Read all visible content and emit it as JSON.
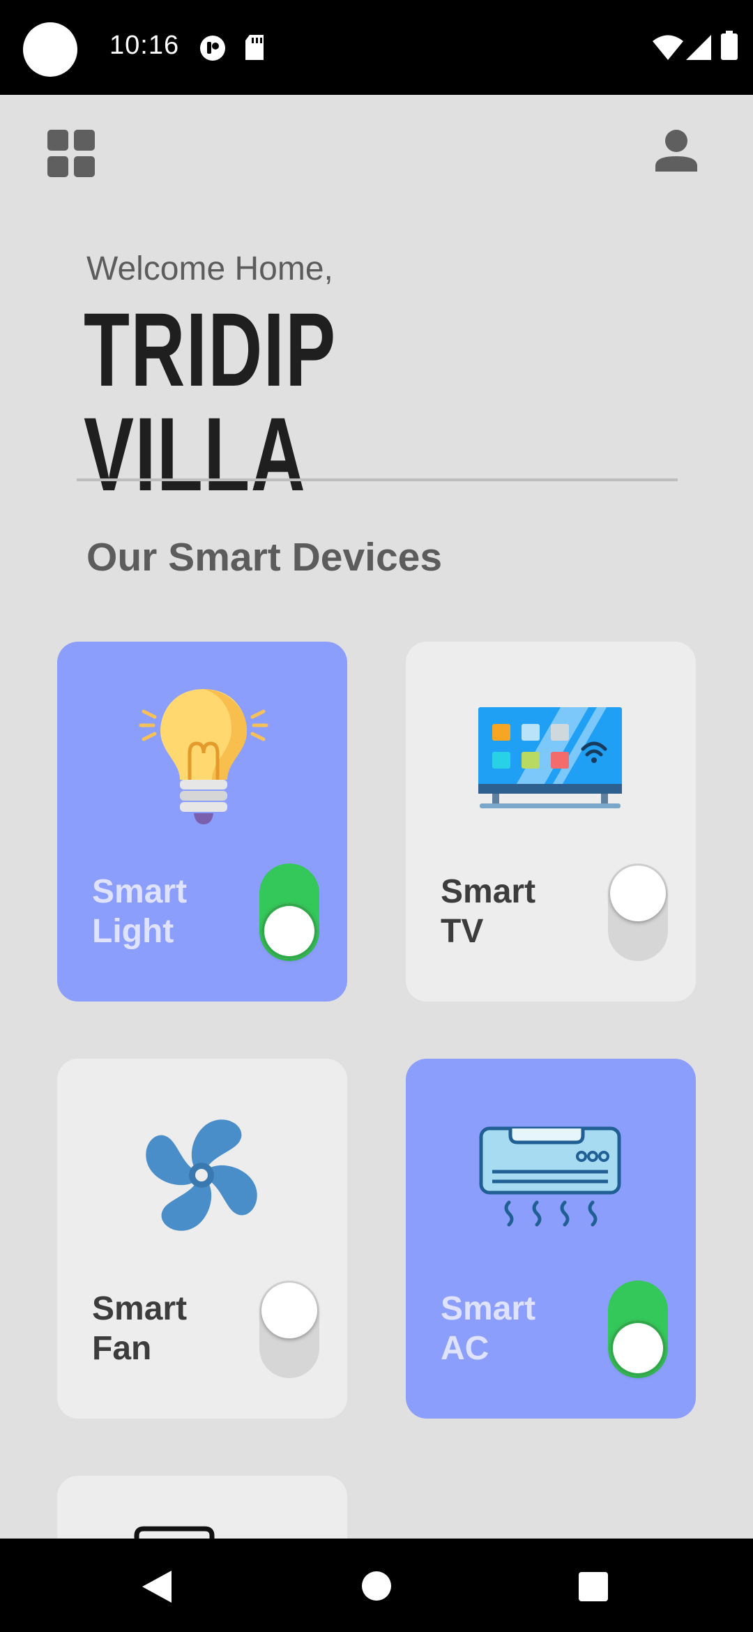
{
  "status_bar": {
    "time": "10:16"
  },
  "header": {
    "menu_icon": "grid-icon",
    "profile_icon": "person-icon",
    "welcome": "Welcome Home,",
    "home_name": "TRIDIP VILLA"
  },
  "section": {
    "title": "Our Smart Devices"
  },
  "devices": [
    {
      "label_line1": "Smart",
      "label_line2": "Light",
      "on": true,
      "icon": "light-bulb-icon"
    },
    {
      "label_line1": "Smart",
      "label_line2": "TV",
      "on": false,
      "icon": "tv-icon"
    },
    {
      "label_line1": "Smart",
      "label_line2": "Fan",
      "on": false,
      "icon": "fan-icon"
    },
    {
      "label_line1": "Smart",
      "label_line2": "AC",
      "on": true,
      "icon": "air-conditioner-icon"
    }
  ],
  "colors": {
    "background": "#e0e0e0",
    "card_on": "#8c9efc",
    "card_off": "#ededed",
    "toggle_on": "#34c759",
    "toggle_off": "#d6d6d6"
  },
  "nav": {
    "back_icon": "back-triangle-icon",
    "home_icon": "home-circle-icon",
    "recents_icon": "recents-square-icon"
  }
}
